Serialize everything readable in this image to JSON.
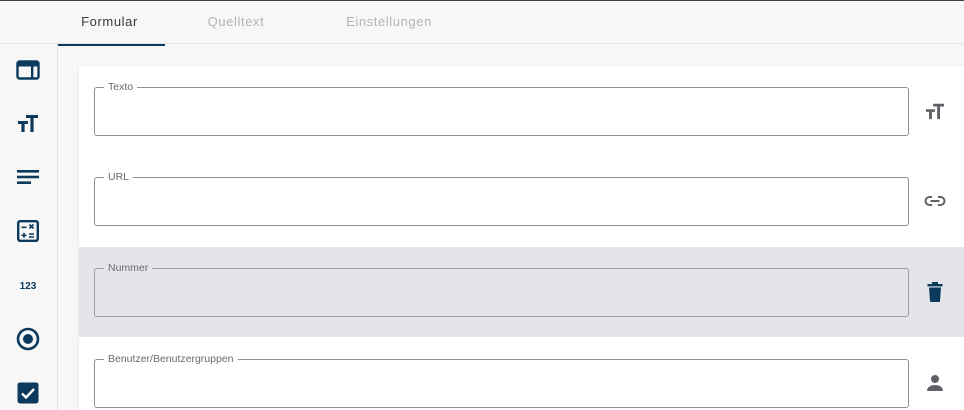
{
  "tabs": [
    {
      "label": "Formular",
      "active": true
    },
    {
      "label": "Quelltext",
      "active": false
    },
    {
      "label": "Einstellungen",
      "active": false
    }
  ],
  "sidebar": {
    "items": [
      {
        "icon": "panel-layout-icon"
      },
      {
        "icon": "text-size-icon"
      },
      {
        "icon": "paragraph-lines-icon"
      },
      {
        "icon": "calculator-icon"
      },
      {
        "icon": "number-123-icon"
      },
      {
        "icon": "radio-button-icon"
      },
      {
        "icon": "checkbox-checked-icon"
      }
    ]
  },
  "form": {
    "fields": [
      {
        "label": "Texto",
        "value": "",
        "action_icon": "text-size-icon"
      },
      {
        "label": "URL",
        "value": "",
        "action_icon": "link-icon"
      },
      {
        "label": "Nummer",
        "value": "",
        "action_icon": "delete-icon",
        "selected": true
      },
      {
        "label": "Benutzer/Benutzergruppen",
        "value": "",
        "action_icon": "person-icon"
      }
    ]
  },
  "colors": {
    "accent": "#0b3a5c",
    "selected_row": "#e3e5ea",
    "inactive_tab": "#b3b3b8",
    "row_icon": "#606066"
  }
}
